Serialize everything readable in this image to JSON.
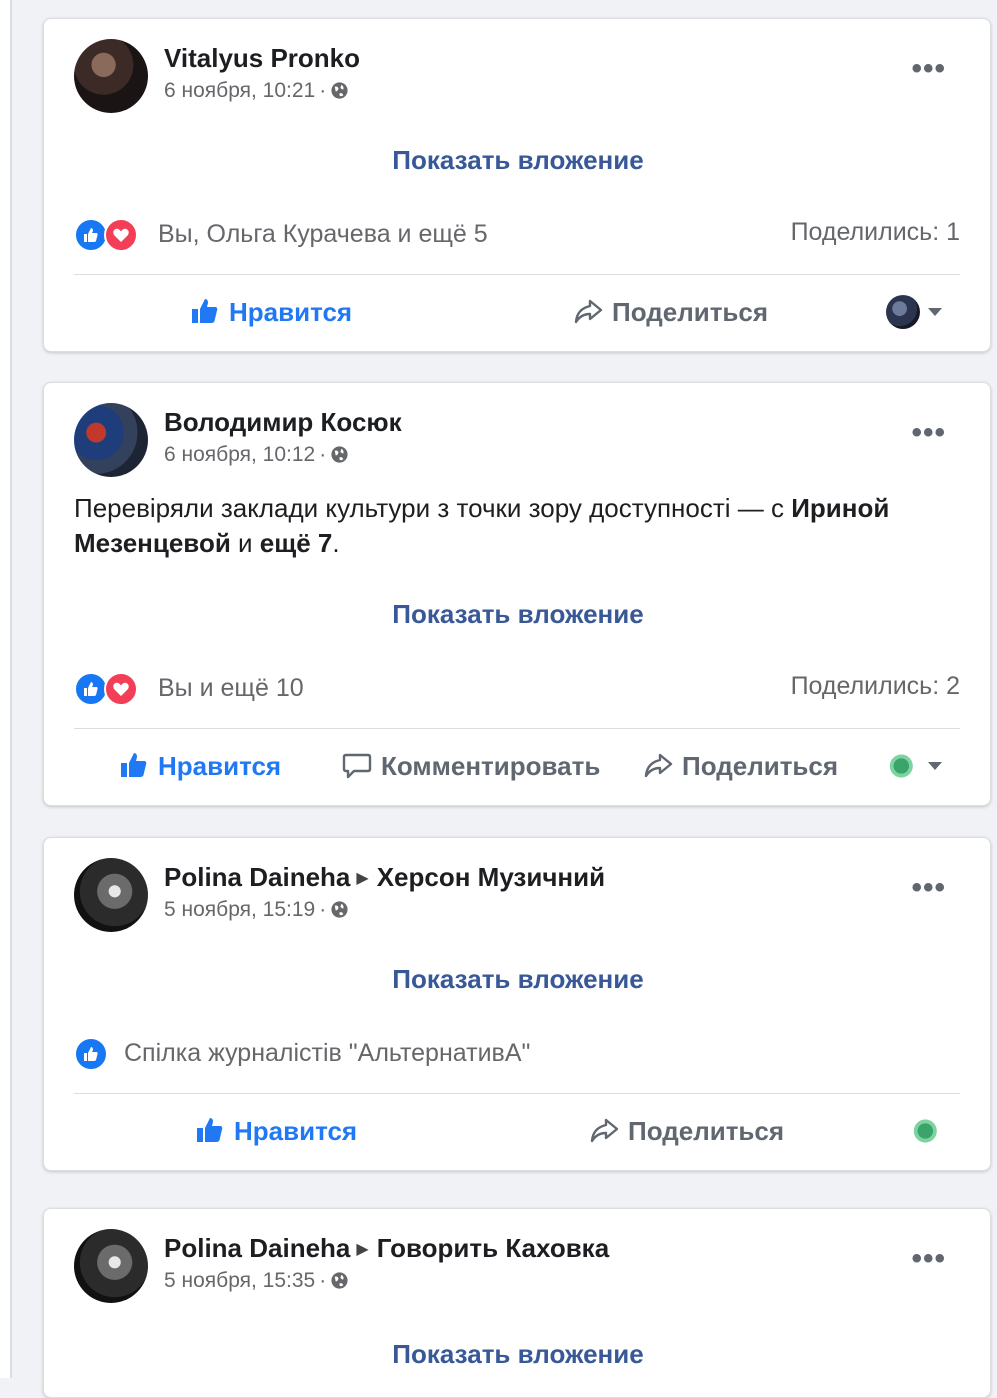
{
  "posts": [
    {
      "author": "Vitalyus Pronko",
      "date": "6 ноября, 10:21",
      "separator": "·",
      "more": "•••",
      "attachment": "Показать вложение",
      "reactions_text": "Вы, Ольга Курачева и ещё 5",
      "shares": "Поделились: 1",
      "actions": {
        "like": "Нравится",
        "share": "Поделиться"
      }
    },
    {
      "author": "Володимир Косюк",
      "date": "6 ноября, 10:12",
      "separator": "·",
      "more": "•••",
      "text_start": "Перевіряли заклади культури з точки зору доступності — с ",
      "text_bold_1": "Ириной Мезенцевой",
      "text_mid": " и ",
      "text_bold_2": "ещё 7",
      "text_end": ".",
      "attachment": "Показать вложение",
      "reactions_text": "Вы и ещё 10",
      "shares": "Поделились: 2",
      "actions": {
        "like": "Нравится",
        "comment": "Комментировать",
        "share": "Поделиться"
      }
    },
    {
      "author": "Polina Daineha",
      "target": "Херсон Музичний",
      "date": "5 ноября, 15:19",
      "separator": "·",
      "more": "•••",
      "attachment": "Показать вложение",
      "reactions_text": "Спілка журналістів \"АльтернативА\"",
      "actions": {
        "like": "Нравится",
        "share": "Поделиться"
      }
    },
    {
      "author": "Polina Daineha",
      "target": "Говорить Каховка",
      "date": "5 ноября, 15:35",
      "separator": "·",
      "more": "•••",
      "attachment": "Показать вложение"
    }
  ],
  "colors": {
    "link": "#385898",
    "like_blue": "#2078f4",
    "love_red": "#f33e58",
    "meta_gray": "#65676b"
  },
  "icons": [
    "globe-icon",
    "more-icon",
    "like-reaction-icon",
    "love-reaction-icon",
    "thumbs-up-icon",
    "share-arrow-icon",
    "comment-bubble-icon",
    "caret-down-icon"
  ]
}
